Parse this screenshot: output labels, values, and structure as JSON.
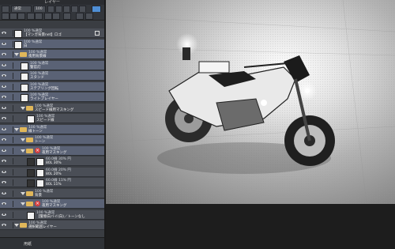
{
  "panel": {
    "title": "レイヤー",
    "blend_mode": "通常",
    "opacity_value": "100"
  },
  "layers": [
    {
      "line1": "100 %通常",
      "line2": "【マンガ背景net】ロゴ",
      "type": "raster",
      "selected": false
    },
    {
      "line1": "100 %通常",
      "line2": "白",
      "type": "raster",
      "selected": true
    },
    {
      "line1": "100 %通常",
      "line2": "夜用背景線",
      "type": "folder",
      "selected": true
    },
    {
      "line1": "100 %通常",
      "line2": "警官灯",
      "type": "raster",
      "selected": true
    },
    {
      "line1": "100 %通常",
      "line2": "スタンド",
      "type": "raster",
      "selected": true
    },
    {
      "line1": "100 %通常",
      "line2": "ステアリング回転",
      "type": "raster",
      "selected": true
    },
    {
      "line1": "100 %通常",
      "line2": "ライトプレイヤー",
      "type": "raster",
      "selected": true
    },
    {
      "line1": "100 %通常",
      "line2": "スピード線用マスキング",
      "type": "folder",
      "selected": false
    },
    {
      "line1": "100 %通常",
      "line2": "スピード線",
      "type": "raster",
      "selected": false
    },
    {
      "line1": "100 %通常",
      "line2": "線トーン",
      "type": "folder",
      "selected": true
    },
    {
      "line1": "100 %通常",
      "line2": "トーン",
      "type": "folder",
      "selected": true
    },
    {
      "line1": "100 %通常",
      "line2": "夜用マスキング",
      "type": "mask",
      "selected": true
    },
    {
      "line1": "60.0線 30% 円",
      "line2": "80L 30%",
      "type": "tone",
      "selected": false
    },
    {
      "line1": "60.0線 20% 円",
      "line2": "80L 20%",
      "type": "tone",
      "selected": false
    },
    {
      "line1": "60.0線 11% 円",
      "line2": "80L 11%",
      "type": "tone",
      "selected": false
    },
    {
      "line1": "100 %通常",
      "line2": "背景",
      "type": "folder",
      "selected": false
    },
    {
      "line1": "100 %通常",
      "line2": "夜用マスキング",
      "type": "mask",
      "selected": true
    },
    {
      "line1": "100 %通常",
      "line2": "【警察白バイ(白)／トーンなし",
      "type": "raster",
      "selected": false
    },
    {
      "line1": "100 %通常",
      "line2": "選択範囲レイヤー",
      "type": "folder",
      "selected": false
    }
  ],
  "bottom_bar": {
    "label": "用紙"
  },
  "colors": {
    "panel": "#3a3d42",
    "selected": "#5a6275",
    "accent": "#4f8fd6"
  }
}
